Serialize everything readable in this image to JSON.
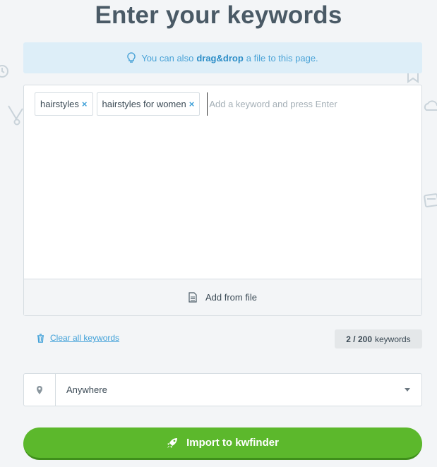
{
  "title": "Enter your keywords",
  "hint": {
    "prefix": "You can also",
    "emphasis": "drag&drop",
    "suffix": "a file to this page.",
    "icon": "lightbulb-icon"
  },
  "keywords": {
    "tags": [
      {
        "label": "hairstyles",
        "remove": "×"
      },
      {
        "label": "hairstyles for women",
        "remove": "×"
      }
    ],
    "input_placeholder": "Add a keyword and press Enter",
    "input_value": ""
  },
  "add_from_file": {
    "label": "Add from file",
    "icon": "file-icon"
  },
  "clear_all": {
    "label": "Clear all keywords",
    "icon": "trash-icon"
  },
  "counter": {
    "current": "2 / 200",
    "unit": "keywords"
  },
  "location": {
    "value": "Anywhere",
    "icon": "map-pin-icon"
  },
  "import_button": {
    "label": "Import to kwfinder",
    "icon": "rocket-icon"
  },
  "colors": {
    "accent": "#3fa0d8",
    "hint_bg": "#ddeef8",
    "primary_button": "#5cb82c",
    "page_bg": "#f3f5f7"
  }
}
